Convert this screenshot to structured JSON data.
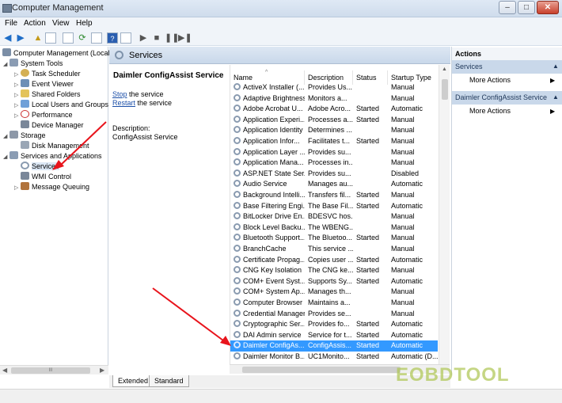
{
  "window": {
    "title": "Computer Management",
    "controls": [
      "–",
      "□",
      "✕"
    ]
  },
  "menubar": [
    "File",
    "Action",
    "View",
    "Help"
  ],
  "tree": {
    "root": "Computer Management (Local",
    "system_tools": "System Tools",
    "task_scheduler": "Task Scheduler",
    "event_viewer": "Event Viewer",
    "shared_folders": "Shared Folders",
    "local_users": "Local Users and Groups",
    "performance": "Performance",
    "device_manager": "Device Manager",
    "storage": "Storage",
    "disk_management": "Disk Management",
    "services_apps": "Services and Applications",
    "services": "Services",
    "wmi_control": "WMI Control",
    "message_queuing": "Message Queuing",
    "scroll_symbol": "III"
  },
  "center": {
    "header": "Services",
    "detail": {
      "service_name": "Daimler ConfigAssist Service",
      "stop_link": "Stop",
      "stop_rest": " the service",
      "restart_link": "Restart",
      "restart_rest": " the service",
      "description_label": "Description:",
      "description_text": "ConfigAssist Service"
    },
    "columns": [
      "Name",
      "Description",
      "Status",
      "Startup Type"
    ],
    "rows": [
      [
        "ActiveX Installer (...",
        "Provides Us...",
        "",
        "Manual"
      ],
      [
        "Adaptive Brightness",
        "Monitors a...",
        "",
        "Manual"
      ],
      [
        "Adobe Acrobat U...",
        "Adobe Acro...",
        "Started",
        "Automatic"
      ],
      [
        "Application Experi...",
        "Processes a...",
        "Started",
        "Manual"
      ],
      [
        "Application Identity",
        "Determines ...",
        "",
        "Manual"
      ],
      [
        "Application Infor...",
        "Facilitates t...",
        "Started",
        "Manual"
      ],
      [
        "Application Layer ...",
        "Provides su...",
        "",
        "Manual"
      ],
      [
        "Application Mana...",
        "Processes in...",
        "",
        "Manual"
      ],
      [
        "ASP.NET State Ser...",
        "Provides su...",
        "",
        "Disabled"
      ],
      [
        "Audio Service",
        "Manages au...",
        "",
        "Automatic"
      ],
      [
        "Background Intelli...",
        "Transfers fil...",
        "Started",
        "Manual"
      ],
      [
        "Base Filtering Engi...",
        "The Base Fil...",
        "Started",
        "Automatic"
      ],
      [
        "BitLocker Drive En...",
        "BDESVC hos...",
        "",
        "Manual"
      ],
      [
        "Block Level Backu...",
        "The WBENG...",
        "",
        "Manual"
      ],
      [
        "Bluetooth Support...",
        "The Bluetoo...",
        "Started",
        "Manual"
      ],
      [
        "BranchCache",
        "This service ...",
        "",
        "Manual"
      ],
      [
        "Certificate Propag...",
        "Copies user ...",
        "Started",
        "Automatic"
      ],
      [
        "CNG Key Isolation",
        "The CNG ke...",
        "Started",
        "Manual"
      ],
      [
        "COM+ Event Syst...",
        "Supports Sy...",
        "Started",
        "Automatic"
      ],
      [
        "COM+ System Ap...",
        "Manages th...",
        "",
        "Manual"
      ],
      [
        "Computer Browser",
        "Maintains a...",
        "",
        "Manual"
      ],
      [
        "Credential Manager",
        "Provides se...",
        "",
        "Manual"
      ],
      [
        "Cryptographic Ser...",
        "Provides fo...",
        "Started",
        "Automatic"
      ],
      [
        "DAI Admin service",
        "Service for t...",
        "Started",
        "Automatic"
      ],
      [
        "Daimler ConfigAs...",
        "ConfigAssis...",
        "Started",
        "Automatic"
      ],
      [
        "Daimler Monitor B...",
        "UC1Monito...",
        "Started",
        "Automatic (D..."
      ]
    ],
    "tabs": [
      "Extended",
      "Standard"
    ]
  },
  "actions": {
    "title": "Actions",
    "sections": [
      {
        "header": "Services",
        "item": "More Actions"
      },
      {
        "header": "Daimler ConfigAssist Service",
        "item": "More Actions"
      }
    ]
  },
  "watermark": "EOBDTOOL",
  "colors": {
    "selection": "#3399ff",
    "annotation_arrow": "#e8141c"
  }
}
